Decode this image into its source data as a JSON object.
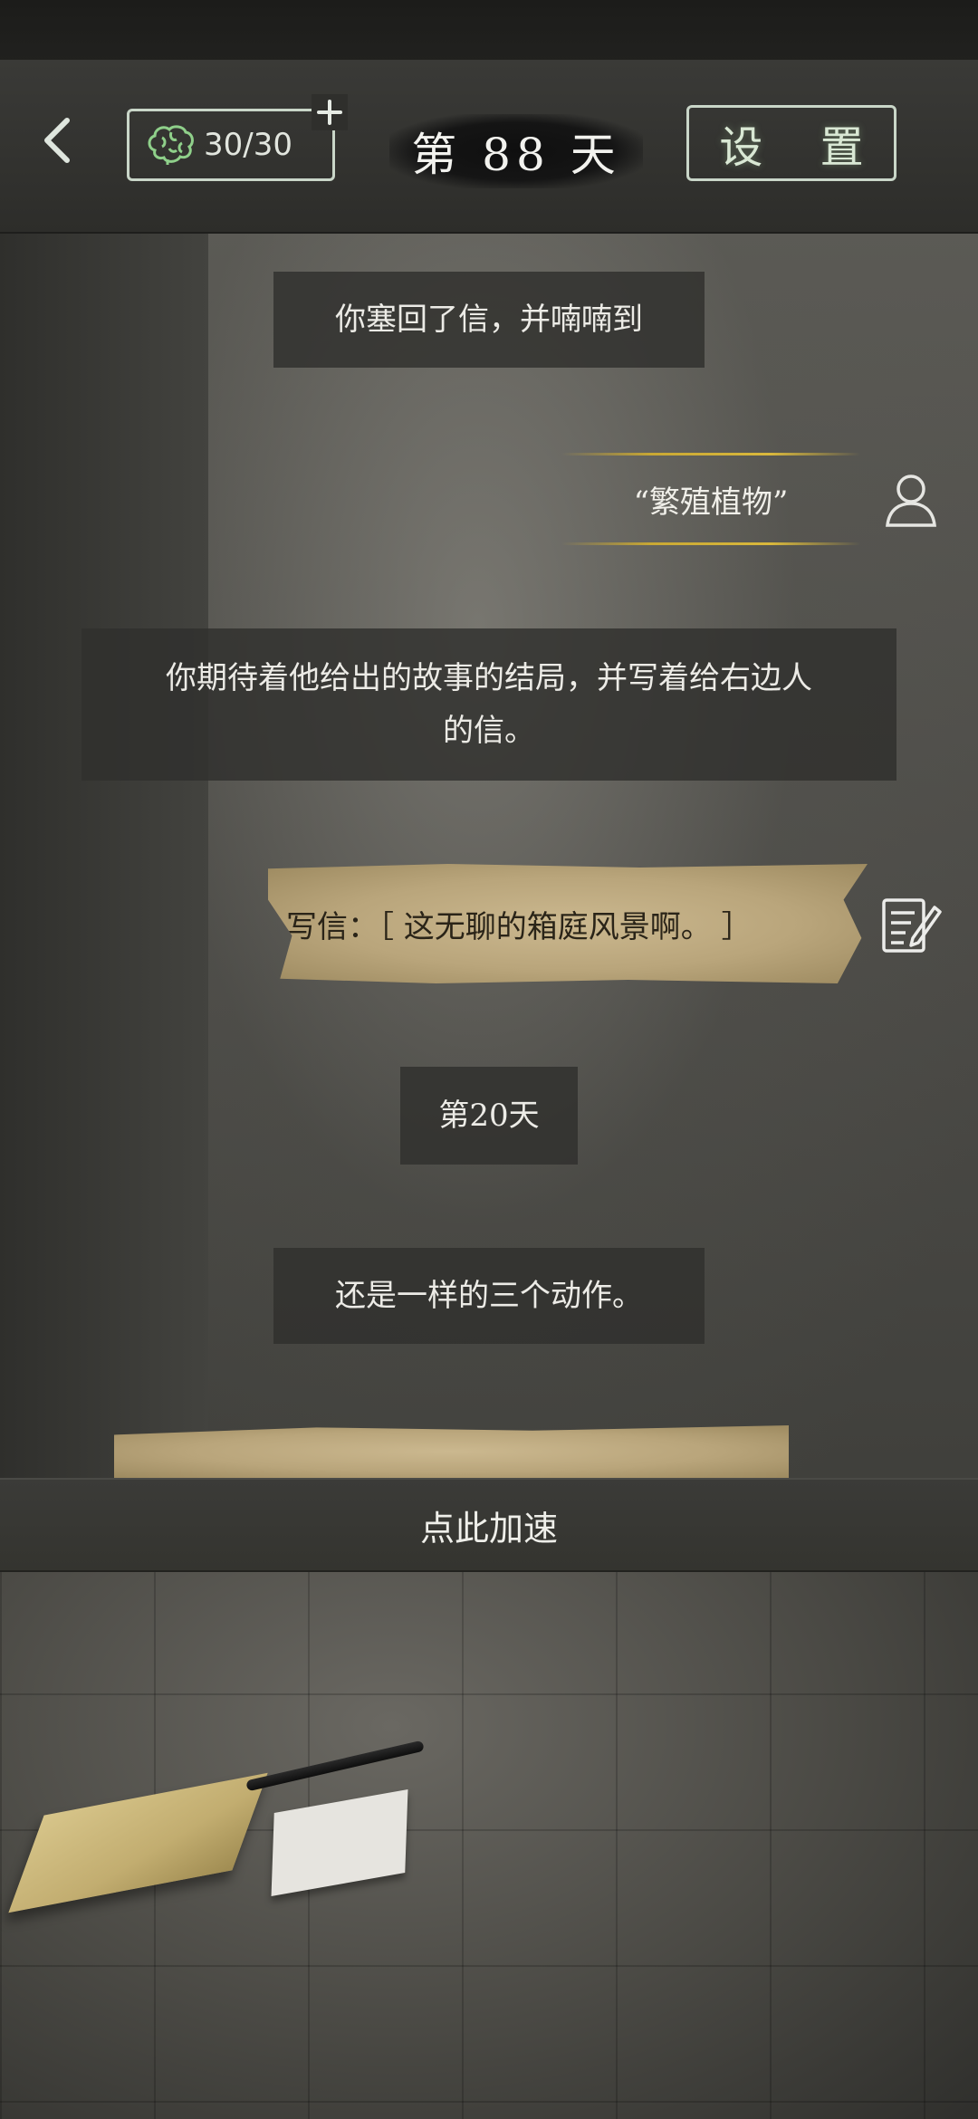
{
  "header": {
    "brain_value": "30/30",
    "day_label": "第 88 天",
    "settings_label": "设 置"
  },
  "story": {
    "msg1": "你塞回了信，并喃喃到",
    "quote": "“繁殖植物”",
    "msg2_line1": "你期待着他给出的故事的结局，并写着给右边人",
    "msg2_line2": "的信。",
    "letter": "写信：［ 这无聊的箱庭风景啊。 ］",
    "day20": "第20天",
    "msg3": "还是一样的三个动作。"
  },
  "speed_label": "点此加速",
  "icons": {
    "back": "chevron-left-icon",
    "brain": "brain-icon",
    "plus": "plus-icon",
    "person": "person-icon",
    "note": "note-edit-icon"
  },
  "colors": {
    "accent_green": "#c9d6c8",
    "quote_gold": "#c9a834",
    "paper": "#b9a57b"
  }
}
